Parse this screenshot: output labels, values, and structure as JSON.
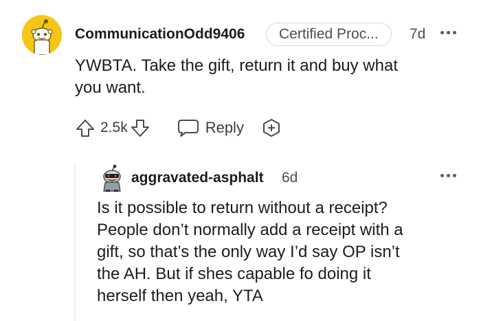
{
  "comment": {
    "username": "CommunicationOdd9406",
    "flair": "Certified Proc...",
    "time": "7d",
    "body_lines": [
      "YWBTA. Take the gift, return it and buy what",
      "you want."
    ],
    "votes": "2.5k",
    "reply_label": "Reply",
    "avatar_color": "#f5c518"
  },
  "reply": {
    "username": "aggravated-asphalt",
    "time": "6d",
    "body_lines": [
      "Is it possible to return without a receipt?",
      "People don’t normally add a receipt with a",
      "gift, so that’s the only way I’d say OP isn’t",
      "the AH. But if shes capable fo doing it",
      "herself then yeah, YTA"
    ]
  },
  "icons": {
    "avatar_main": "snoo-avatar-icon",
    "avatar_reply": "snoo-avatar-icon",
    "upvote": "upvote-arrow-icon",
    "downvote": "downvote-arrow-icon",
    "reply": "chat-bubble-icon",
    "award": "award-plus-icon",
    "more": "more-horizontal-icon"
  }
}
